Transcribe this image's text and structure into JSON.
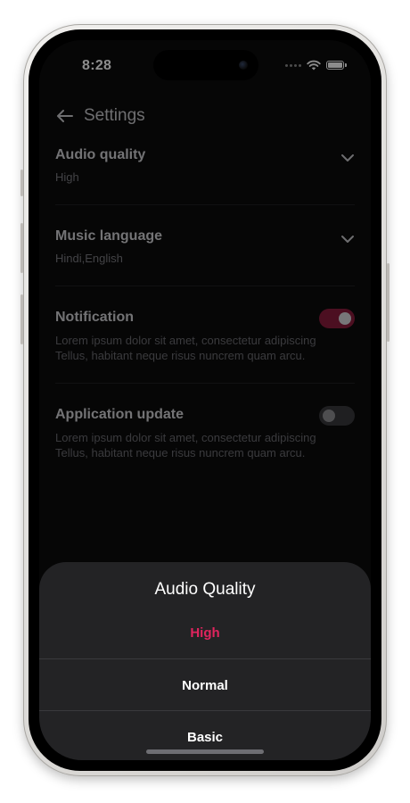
{
  "status_bar": {
    "time": "8:28"
  },
  "header": {
    "title": "Settings"
  },
  "settings": {
    "audio_quality": {
      "title": "Audio quality",
      "value": "High"
    },
    "music_language": {
      "title": "Music language",
      "value": "Hindi,English"
    },
    "notification": {
      "title": "Notification",
      "description": "Lorem ipsum dolor sit amet, consectetur adipiscing Tellus, habitant neque risus nuncrem quam arcu.",
      "enabled": true
    },
    "application_update": {
      "title": "Application update",
      "description": "Lorem ipsum dolor sit amet, consectetur adipiscing Tellus, habitant neque risus nuncrem quam arcu.",
      "enabled": false
    }
  },
  "sheet": {
    "title": "Audio Quality",
    "options": [
      {
        "label": "High",
        "selected": true
      },
      {
        "label": "Normal",
        "selected": false
      },
      {
        "label": "Basic",
        "selected": false
      }
    ]
  },
  "colors": {
    "accent": "#e0245e",
    "toggle_on": "#8a1d3c",
    "toggle_off": "#3a3a3c"
  }
}
